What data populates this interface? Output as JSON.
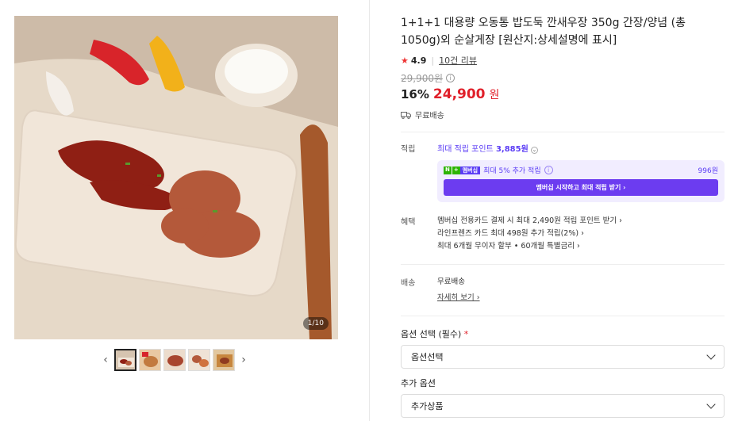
{
  "gallery": {
    "counter": "1/10",
    "prev_arrow": "‹",
    "next_arrow": "›",
    "thumbnails": 5
  },
  "product": {
    "title": "1+1+1 대용량 오동통 밥도둑 깐새우장 350g 간장/양념 (총1050g)외 순살게장 [원산지:상세설명에 표시]",
    "rating_star": "★",
    "rating": "4.9",
    "review_link": "10건 리뷰",
    "original_price": "29,900원",
    "discount": "16%",
    "price": "24,900",
    "currency": "원",
    "shipping_top": "무료배송"
  },
  "points": {
    "label": "적립",
    "max_points_text": "최대 적립 포인트",
    "max_points_value": "3,885원",
    "membership_badge": "멤버십",
    "membership_extra": "최대 5% 추가 적립",
    "membership_amount": "996원",
    "membership_button": "멤버십 시작하고 최대 적립 받기 ›"
  },
  "benefits": {
    "label": "혜택",
    "lines": [
      "멤버십 전용카드 결제 시 최대 2,490원 적립 포인트 받기 ›",
      "라인프렌즈 카드 최대 498원 추가 적립(2%) ›",
      "최대 6개월 무이자 할부 • 60개월 특별금리 ›"
    ]
  },
  "delivery": {
    "label": "배송",
    "value": "무료배송",
    "detail_link": "자세히 보기 ›"
  },
  "options": {
    "required_label": "옵션 선택 (필수)",
    "required_mark": "*",
    "required_value": "옵션선택",
    "extra_label": "추가 옵션",
    "extra_value": "추가상품"
  },
  "colors": {
    "accent_price": "#e0202a",
    "membership_purple": "#6c3cf0"
  }
}
